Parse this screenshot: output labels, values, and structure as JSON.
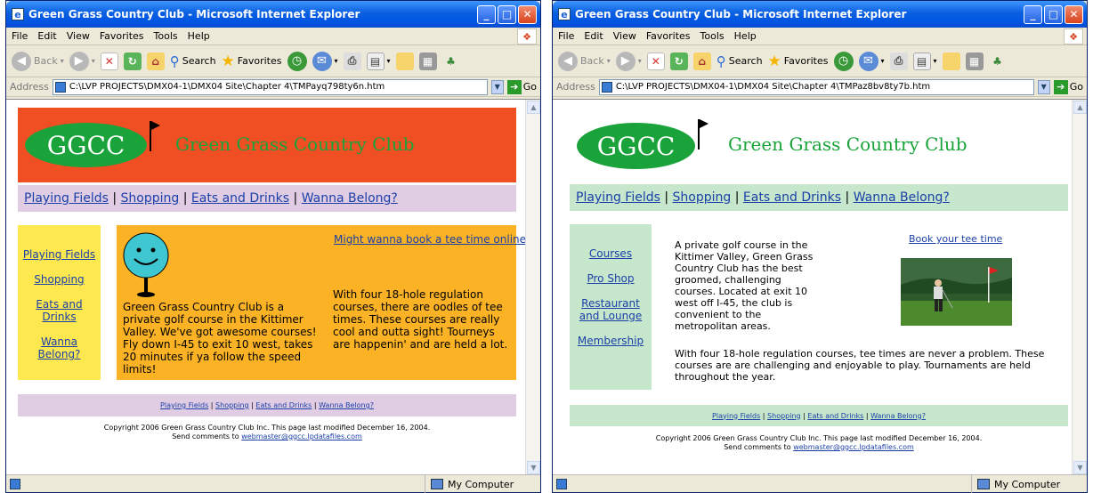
{
  "windows": [
    {
      "title": "Green Grass Country Club - Microsoft Internet Explorer",
      "menu": [
        "File",
        "Edit",
        "View",
        "Favorites",
        "Tools",
        "Help"
      ],
      "toolbar": {
        "back": "Back",
        "search": "Search",
        "favorites": "Favorites"
      },
      "address": {
        "label": "Address",
        "url": "C:\\LVP PROJECTS\\DMX04-1\\DMX04 Site\\Chapter 4\\TMPayq798ty6n.htm",
        "go": "Go"
      },
      "status": {
        "zone": "My Computer"
      },
      "page": {
        "logo_text": "GGCC",
        "club_name": "Green Grass Country Club",
        "nav": [
          "Playing Fields",
          "Shopping",
          "Eats and Drinks",
          "Wanna Belong?"
        ],
        "side": [
          "Playing Fields",
          "Shopping",
          "Eats and Drinks",
          "Wanna Belong?"
        ],
        "book_link": "Might wanna book a tee time online",
        "para1": "Green Grass Country Club is a private golf course in the Kittimer Valley. We've got awesome courses! Fly down I-45 to exit 10 west, takes 20 minutes if ya follow the speed limits!",
        "para2": "With four 18-hole regulation courses, there are oodles of tee times. These courses are really cool and outta sight! Tourneys are happenin' and are held a lot.",
        "footer_nav": [
          "Playing Fields",
          "Shopping",
          "Eats and Drinks",
          "Wanna Belong?"
        ],
        "copyright": "Copyright 2006 Green Grass Country Club Inc. This page last modified December 16, 2004.",
        "send": "Send comments to",
        "email": "webmaster@ggcc.lpdatafiles.com"
      }
    },
    {
      "title": "Green Grass Country Club - Microsoft Internet Explorer",
      "menu": [
        "File",
        "Edit",
        "View",
        "Favorites",
        "Tools",
        "Help"
      ],
      "toolbar": {
        "back": "Back",
        "search": "Search",
        "favorites": "Favorites"
      },
      "address": {
        "label": "Address",
        "url": "C:\\LVP PROJECTS\\DMX04-1\\DMX04 Site\\Chapter 4\\TMPaz8bv8ty7b.htm",
        "go": "Go"
      },
      "status": {
        "zone": "My Computer"
      },
      "page": {
        "logo_text": "GGCC",
        "club_name": "Green Grass Country Club",
        "nav": [
          "Playing Fields",
          "Shopping",
          "Eats and Drinks",
          "Wanna Belong?"
        ],
        "side": [
          "Courses",
          "Pro Shop",
          "Restaurant and Lounge",
          "Membership"
        ],
        "book_link": "Book your tee time",
        "para1": "A private golf course in the Kittimer Valley, Green Grass Country Club has the best groomed, challenging courses. Located at exit 10 west off I-45, the club is convenient to the metropolitan areas.",
        "para2": "With four 18-hole regulation courses, tee times are never a problem. These courses are are challenging and enjoyable to play. Tournaments are held throughout the year.",
        "footer_nav": [
          "Playing Fields",
          "Shopping",
          "Eats and Drinks",
          "Wanna Belong?"
        ],
        "copyright": "Copyright 2006 Green Grass Country Club Inc. This page last modified December 16, 2004.",
        "send": "Send comments to",
        "email": "webmaster@ggcc.lpdatafiles.com"
      }
    }
  ],
  "colors": {
    "left_header_bg": "#f04e23",
    "left_nav_bg": "#e0cde4",
    "left_side_bg": "#fde94f",
    "left_main_bg": "#fbb225",
    "right_nav_bg": "#c6e7cc",
    "logo_green": "#1aa33a"
  }
}
